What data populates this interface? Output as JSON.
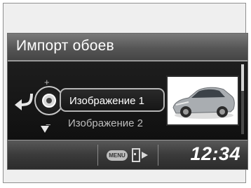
{
  "screen": {
    "title": "Импорт обоев",
    "items": [
      {
        "label": "Изображение 1",
        "selected": true
      },
      {
        "label": "Изображение 2",
        "selected": false
      }
    ],
    "dial": {
      "plus": "+",
      "minus": "−"
    },
    "status": {
      "menu_label": "MENU",
      "clock": "12:34"
    },
    "icons": {
      "back": "back-arrow-icon",
      "dial": "dial-controller-icon",
      "down": "scroll-down-arrow-icon",
      "preview": "car-wallpaper-thumbnail",
      "exit": "exit-door-icon"
    },
    "colors": {
      "accent": "#ffffff",
      "title_gradient_top": "#7a7a7a",
      "panel": "#111111"
    },
    "scroll_position": 0.0
  }
}
